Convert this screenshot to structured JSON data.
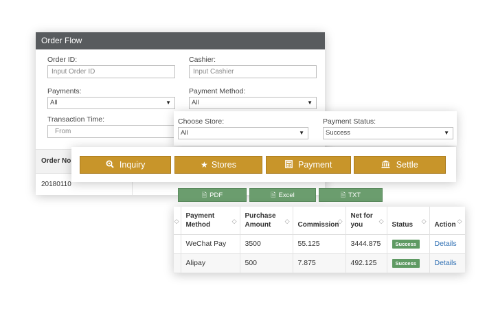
{
  "order_flow": {
    "title": "Order Flow",
    "order_id": {
      "label": "Order ID:",
      "placeholder": "Input Order ID"
    },
    "cashier": {
      "label": "Cashier:",
      "placeholder": "Input Cashier"
    },
    "payments": {
      "label": "Payments:",
      "value": "All"
    },
    "payment_method": {
      "label": "Payment Method:",
      "value": "All"
    },
    "transaction_time": {
      "label": "Transaction Time:",
      "from_placeholder": "From"
    },
    "mini_table": {
      "header": "Order No.",
      "row_value": "20180110"
    }
  },
  "filters": {
    "choose_store": {
      "label": "Choose Store:",
      "value": "All"
    },
    "payment_status": {
      "label": "Payment Status:",
      "value": "Success"
    }
  },
  "actions": {
    "inquiry": {
      "label": "Inquiry",
      "icon": "search-icon"
    },
    "stores": {
      "label": "Stores",
      "icon": "star-icon"
    },
    "payment": {
      "label": "Payment",
      "icon": "calculator-icon"
    },
    "settle": {
      "label": "Settle",
      "icon": "bank-icon"
    }
  },
  "exports": {
    "pdf": "PDF",
    "excel": "Excel",
    "txt": "TXT"
  },
  "table": {
    "columns": [
      "Payment Method",
      "Purchase Amount",
      "Commission",
      "Net for you",
      "Status",
      "Action"
    ],
    "rows": [
      {
        "method": "WeChat Pay",
        "amount": "3500",
        "commission": "55.125",
        "net": "3444.875",
        "status": "Success",
        "action": "Details"
      },
      {
        "method": "Alipay",
        "amount": "500",
        "commission": "7.875",
        "net": "492.125",
        "status": "Success",
        "action": "Details"
      }
    ]
  },
  "colors": {
    "gold_button": "#c8952a",
    "green_button": "#6b9d6e",
    "header_bar": "#585b5e",
    "link": "#2e6fb3"
  }
}
